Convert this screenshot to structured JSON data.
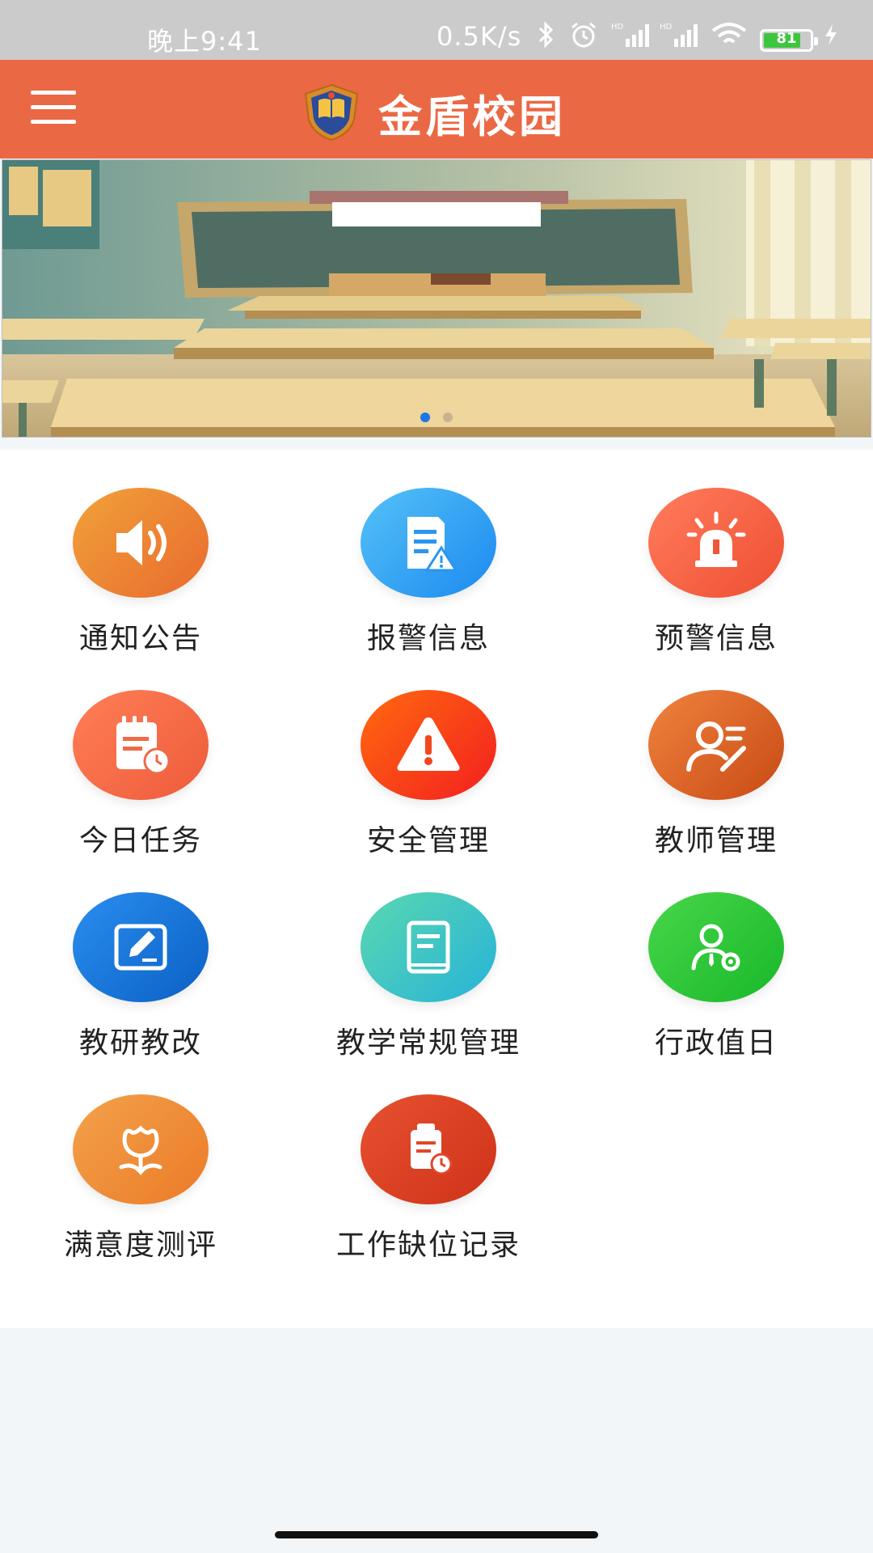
{
  "status_bar": {
    "time": "晚上9:41",
    "net_speed": "0.5K/s",
    "battery_level": "81",
    "battery_fraction": 0.81,
    "icons": [
      "bluetooth-icon",
      "alarm-icon",
      "hd-signal-icon",
      "hd-signal-icon",
      "wifi-icon",
      "battery-icon",
      "charging-icon"
    ]
  },
  "app_bar": {
    "title": "金盾校园",
    "menu_icon": "hamburger-menu-icon",
    "logo_icon": "shield-logo-icon",
    "color": "#eb6844"
  },
  "banner": {
    "slides": 2,
    "active_slide": 1,
    "dot_active_color": "#1f74e8",
    "dot_inactive_color": "#c7b48f"
  },
  "grid": {
    "items": [
      {
        "label": "通知公告",
        "icon": "speaker-icon",
        "gradient": [
          "#f1a23a",
          "#e96a2e"
        ]
      },
      {
        "label": "报警信息",
        "icon": "document-warning-icon",
        "gradient": [
          "#55c2f7",
          "#1c89f0"
        ]
      },
      {
        "label": "预警信息",
        "icon": "siren-icon",
        "gradient": [
          "#ff7d5c",
          "#ef4e32"
        ]
      },
      {
        "label": "今日任务",
        "icon": "calendar-clock-icon",
        "gradient": [
          "#ff7f57",
          "#ee5b3a"
        ]
      },
      {
        "label": "安全管理",
        "icon": "warning-triangle-icon",
        "gradient": [
          "#ff6a10",
          "#f31f1f"
        ]
      },
      {
        "label": "教师管理",
        "icon": "teacher-icon",
        "gradient": [
          "#f0833e",
          "#c84a14"
        ]
      },
      {
        "label": "教研教改",
        "icon": "edit-pen-icon",
        "gradient": [
          "#2a8ef0",
          "#0b60c4"
        ]
      },
      {
        "label": "教学常规管理",
        "icon": "book-icon",
        "gradient": [
          "#5ad8b0",
          "#27b3d8"
        ]
      },
      {
        "label": "行政值日",
        "icon": "admin-person-gear-icon",
        "gradient": [
          "#49d64a",
          "#18b82a"
        ]
      },
      {
        "label": "满意度测评",
        "icon": "flower-icon",
        "gradient": [
          "#f2a24a",
          "#ec7a28"
        ]
      },
      {
        "label": "工作缺位记录",
        "icon": "record-clock-icon",
        "gradient": [
          "#e6512f",
          "#cf3219"
        ]
      }
    ]
  }
}
